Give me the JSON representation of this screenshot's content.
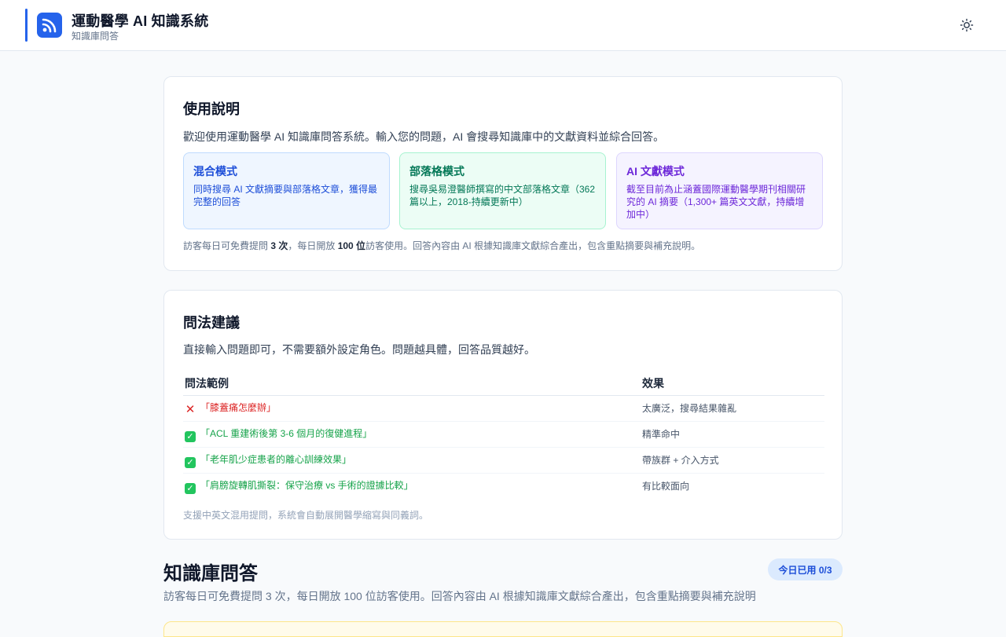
{
  "header": {
    "title": "運動醫學 AI 知識系統",
    "subtitle": "知識庫問答",
    "logo_icon": "rss-feed-icon",
    "theme_icon": "sun-icon",
    "accent_color": "#2563eb"
  },
  "usage_card": {
    "title": "使用說明",
    "description": "歡迎使用運動醫學 AI 知識庫問答系統。輸入您的問題，AI 會搜尋知識庫中的文獻資料並綜合回答。",
    "modes": [
      {
        "title": "混合模式",
        "description": "同時搜尋 AI 文獻摘要與部落格文章，獲得最完整的回答",
        "color": "#1d4ed8"
      },
      {
        "title": "部落格模式",
        "description": "搜尋吳易澄醫師撰寫的中文部落格文章（362 篇以上，2018-持續更新中）",
        "color": "#047857"
      },
      {
        "title": "AI 文獻模式",
        "description": "截至目前為止涵蓋國際運動醫學期刊相關研究的 AI 摘要（1,300+ 篇英文文獻，持續增加中）",
        "color": "#6d28d9"
      }
    ],
    "note": {
      "prefix": "訪客每日可免費提問 ",
      "count": "3 次",
      "middle": "，每日開放 ",
      "visitors": "100 位",
      "suffix": "訪客使用。回答內容由 AI 根據知識庫文獻綜合產出，包含重點摘要與補充說明。"
    }
  },
  "tips_card": {
    "title": "問法建議",
    "description": "直接輸入問題即可，不需要額外設定角色。問題越具體，回答品質越好。",
    "columns": [
      "問法範例",
      "效果"
    ],
    "rows": [
      {
        "mark": "✕",
        "good": false,
        "example": "「膝蓋痛怎麼辦」",
        "effect": "太廣泛，搜尋結果雜亂"
      },
      {
        "mark": "✓",
        "good": true,
        "example": "「ACL 重建術後第 3-6 個月的復健進程」",
        "effect": "精準命中"
      },
      {
        "mark": "✓",
        "good": true,
        "example": "「老年肌少症患者的離心訓練效果」",
        "effect": "帶族群 + 介入方式"
      },
      {
        "mark": "✓",
        "good": true,
        "example": "「肩膀旋轉肌撕裂：保守治療 vs 手術的證據比較」",
        "effect": "有比較面向"
      }
    ],
    "footnote": "支援中英文混用提問，系統會自動展開醫學縮寫與同義詞。"
  },
  "qa_section": {
    "title": "知識庫問答",
    "usage_badge": "今日已用 0/3",
    "description": "訪客每日可免費提問 3 次，每日開放 100 位訪客使用。回答內容由 AI 根據知識庫文獻綜合產出，包含重點摘要與補充說明"
  }
}
